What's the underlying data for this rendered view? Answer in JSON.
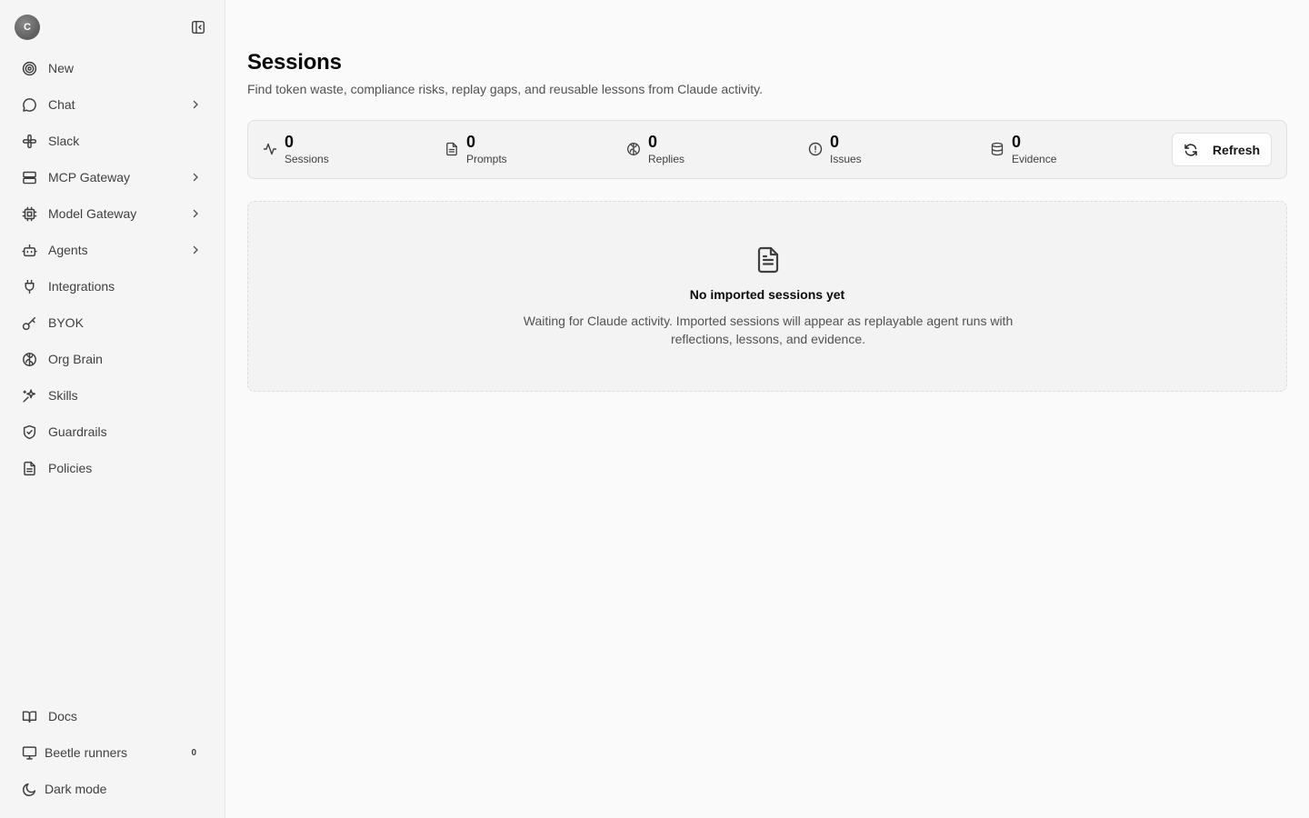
{
  "user": {
    "avatar_initial": "C"
  },
  "sidebar": {
    "items": [
      {
        "label": "New",
        "icon": "target-icon",
        "has_chevron": false
      },
      {
        "label": "Chat",
        "icon": "chat-icon",
        "has_chevron": true
      },
      {
        "label": "Slack",
        "icon": "slack-icon",
        "has_chevron": false
      },
      {
        "label": "MCP Gateway",
        "icon": "server-icon",
        "has_chevron": true
      },
      {
        "label": "Model Gateway",
        "icon": "cpu-icon",
        "has_chevron": true
      },
      {
        "label": "Agents",
        "icon": "bot-icon",
        "has_chevron": true
      },
      {
        "label": "Integrations",
        "icon": "plug-icon",
        "has_chevron": false
      },
      {
        "label": "BYOK",
        "icon": "key-icon",
        "has_chevron": false
      },
      {
        "label": "Org Brain",
        "icon": "brain-icon",
        "has_chevron": false
      },
      {
        "label": "Skills",
        "icon": "sparkle-icon",
        "has_chevron": false
      },
      {
        "label": "Guardrails",
        "icon": "shield-check-icon",
        "has_chevron": false
      },
      {
        "label": "Policies",
        "icon": "file-text-icon",
        "has_chevron": false
      }
    ],
    "bottom": {
      "docs": "Docs",
      "runners": "Beetle runners",
      "runners_count": "0",
      "dark_mode": "Dark mode"
    }
  },
  "page": {
    "title": "Sessions",
    "subtitle": "Find token waste, compliance risks, replay gaps, and reusable lessons from Claude activity."
  },
  "stats": [
    {
      "value": "0",
      "label": "Sessions",
      "icon": "activity-icon"
    },
    {
      "value": "0",
      "label": "Prompts",
      "icon": "file-text-icon"
    },
    {
      "value": "0",
      "label": "Replies",
      "icon": "brain-icon"
    },
    {
      "value": "0",
      "label": "Issues",
      "icon": "alert-circle-icon"
    },
    {
      "value": "0",
      "label": "Evidence",
      "icon": "database-icon"
    }
  ],
  "refresh_label": "Refresh",
  "empty_state": {
    "title": "No imported sessions yet",
    "text": "Waiting for Claude activity. Imported sessions will appear as replayable agent runs with reflections, lessons, and evidence."
  }
}
